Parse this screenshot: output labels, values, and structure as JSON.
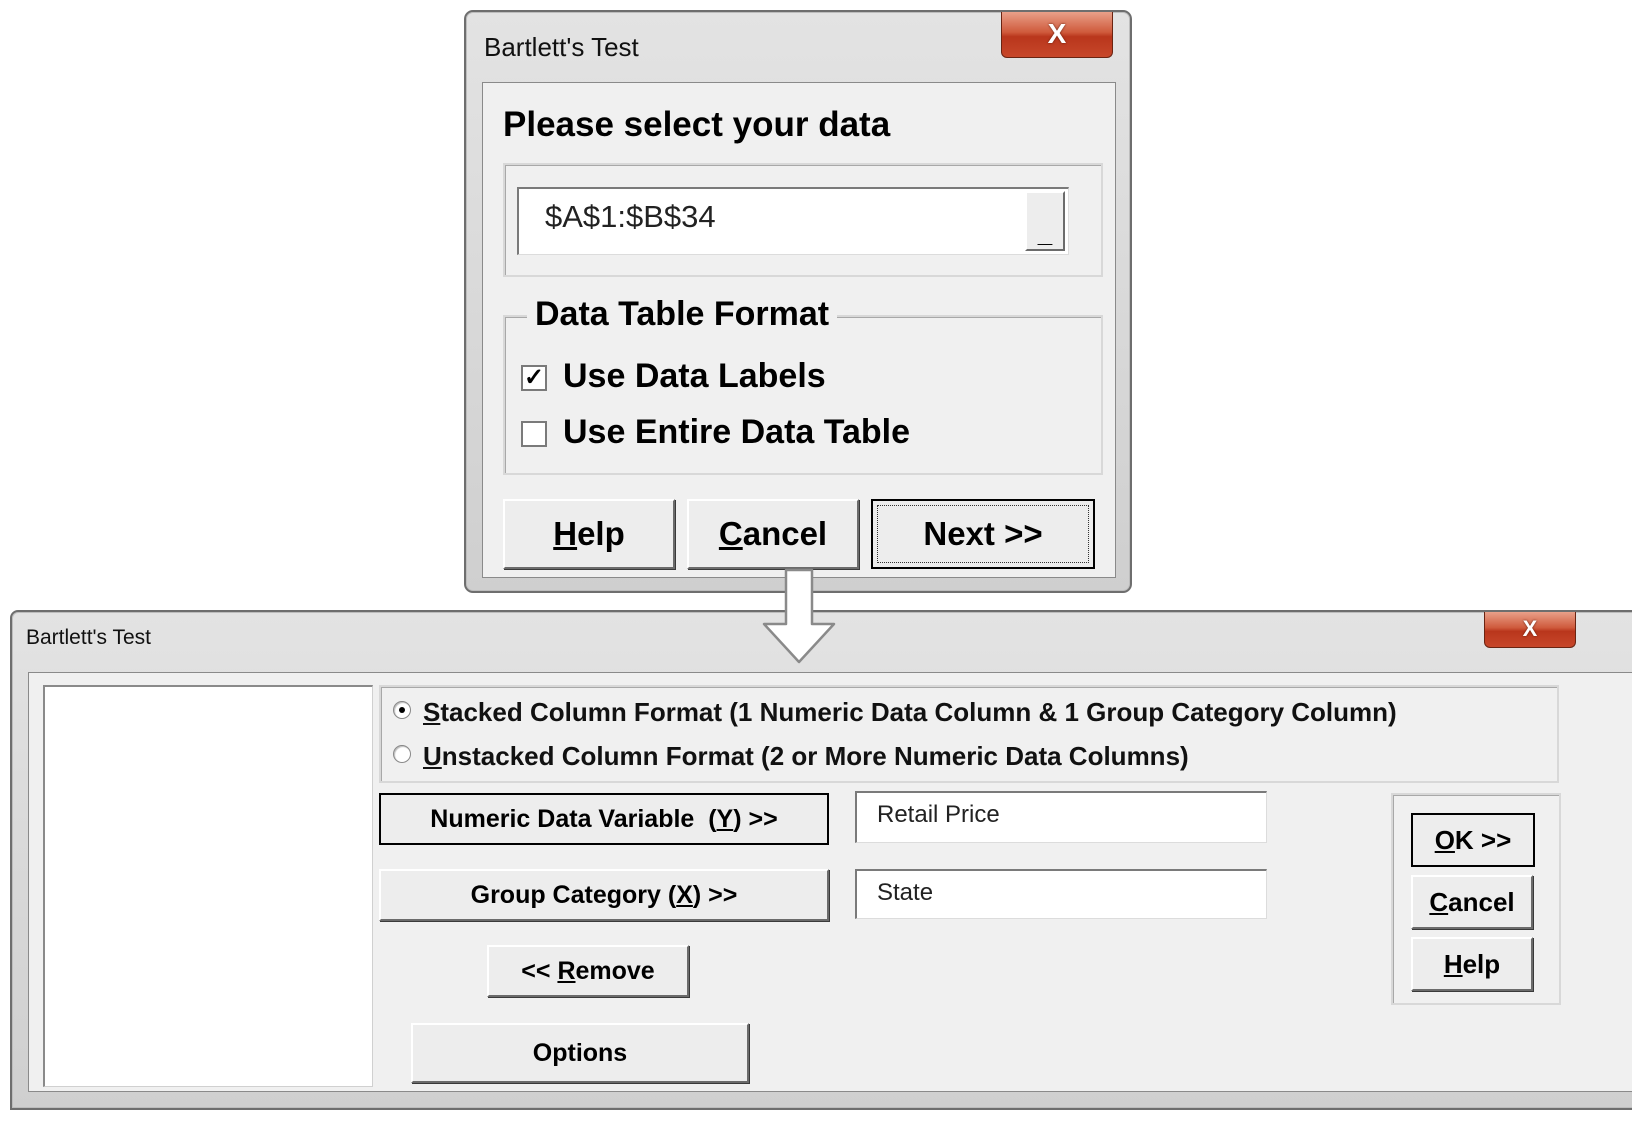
{
  "dialog1": {
    "title": "Bartlett's Test",
    "close_glyph": "X",
    "prompt": "Please select your data",
    "range_value": "$A$1:$B$34",
    "range_button_glyph": "_",
    "format_group_title": "Data Table Format",
    "options": [
      {
        "label": "Use Data Labels",
        "checked": true
      },
      {
        "label": "Use Entire Data Table",
        "checked": false
      }
    ],
    "check_glyph": "✓",
    "buttons": {
      "help": {
        "mnemonic": "H",
        "rest": "elp"
      },
      "cancel": {
        "mnemonic": "C",
        "rest": "ancel"
      },
      "next": {
        "label": "Next >>"
      }
    }
  },
  "dialog2": {
    "title": "Bartlett's Test",
    "close_glyph": "X",
    "format_options": [
      {
        "mnemonic": "S",
        "rest": "tacked Column Format (1 Numeric Data Column & 1 Group Category Column)",
        "selected": true
      },
      {
        "mnemonic": "U",
        "rest": "nstacked Column Format (2 or More Numeric Data Columns)",
        "selected": false
      }
    ],
    "numeric_var_button": {
      "before": "Numeric Data Variable  (",
      "mnemonic": "Y",
      "after": ") >>"
    },
    "numeric_var_value": "Retail Price",
    "group_button": {
      "before": "Group Category (",
      "mnemonic": "X",
      "after": ") >>"
    },
    "group_value": "State",
    "remove_button": {
      "before": "<< ",
      "mnemonic": "R",
      "rest": "emove"
    },
    "options_button": "Options",
    "ok_button": {
      "mnemonic": "O",
      "rest": "K >>"
    },
    "cancel_button": {
      "mnemonic": "C",
      "rest": "ancel"
    },
    "help_button": {
      "mnemonic": "H",
      "rest": "elp"
    }
  },
  "arrow": {
    "icon": "down-arrow-icon",
    "color": "#ffffff"
  },
  "colors": {
    "close_button": "#c7472a",
    "client_bg": "#f0f0f0",
    "frame": "#d4d4d4"
  }
}
